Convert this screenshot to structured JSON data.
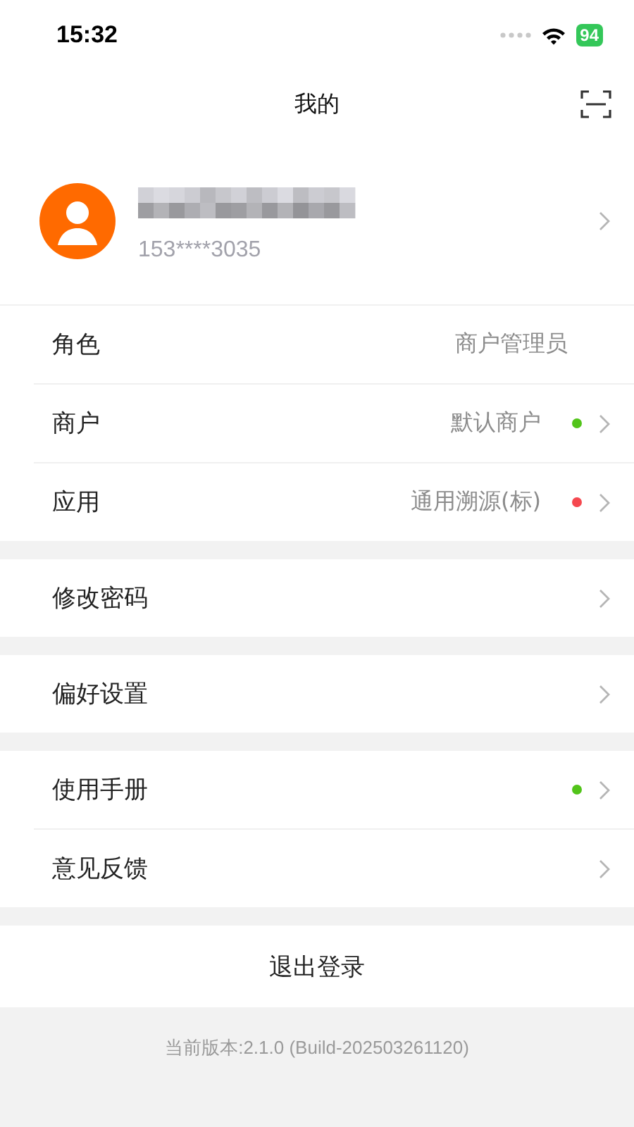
{
  "status_bar": {
    "time": "15:32",
    "battery": "94"
  },
  "header": {
    "title": "我的"
  },
  "profile": {
    "phone": "153****3035",
    "arrow": true
  },
  "groups": [
    {
      "rows": [
        {
          "label": "角色",
          "value": "商户管理员",
          "arrow": false
        },
        {
          "label": "商户",
          "value": "默认商户",
          "color": "#52c41a",
          "arrow": true
        },
        {
          "label": "应用",
          "value": "通用溯源(标)",
          "color": "#f5484f",
          "arrow": true
        }
      ]
    },
    {
      "rows": [
        {
          "label": "修改密码",
          "arrow": true
        }
      ]
    },
    {
      "rows": [
        {
          "label": "偏好设置",
          "arrow": true
        }
      ]
    },
    {
      "rows": [
        {
          "label": "使用手册",
          "color": "#52c41a",
          "arrow": true
        },
        {
          "label": "意见反馈",
          "arrow": true
        }
      ]
    }
  ],
  "logout": "退出登录",
  "version": "当前版本:2.1.0 (Build-202503261120)"
}
